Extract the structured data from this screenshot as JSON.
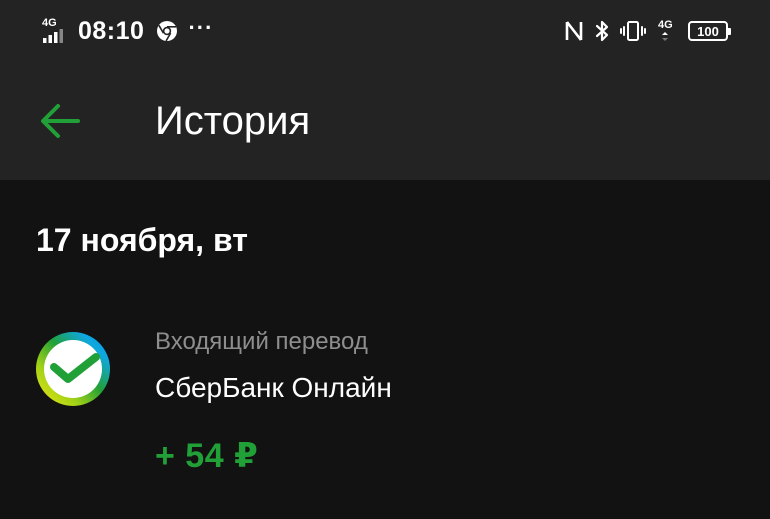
{
  "status_bar": {
    "network_left": "4G",
    "time": "08:10",
    "more": "···",
    "network_right": "4G",
    "battery": "100",
    "icons": [
      "signal-icon",
      "chrome-icon",
      "nfc-icon",
      "bluetooth-icon",
      "vibrate-icon",
      "battery-icon"
    ]
  },
  "app_bar": {
    "back_icon": "arrow-left-icon",
    "title": "История"
  },
  "history": {
    "date": "17 ноября, вт",
    "items": [
      {
        "type": "Входящий перевод",
        "merchant": "СберБанк Онлайн",
        "amount": "+ 54 ₽",
        "logo": "sberbank-logo"
      }
    ]
  },
  "colors": {
    "accent_green": "#21a038",
    "background": "#121212",
    "app_bar": "#232323",
    "secondary_text": "#8e8e8e"
  }
}
